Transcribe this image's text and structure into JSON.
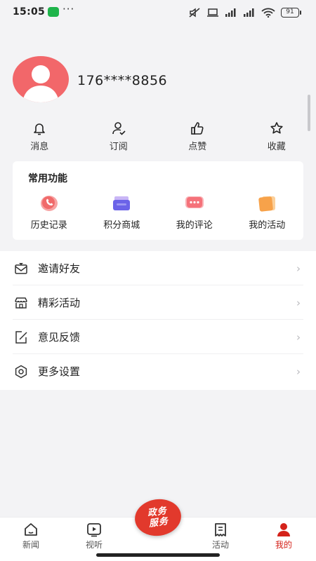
{
  "status_bar": {
    "time": "15:05",
    "battery": "91",
    "icons": [
      "wechat-icon",
      "more-dots-icon",
      "mute-icon",
      "laptop-icon",
      "signal-icon",
      "hd-signal-icon",
      "wifi-icon",
      "battery-icon"
    ]
  },
  "profile": {
    "phone": "176****8856"
  },
  "quick_actions": [
    {
      "label": "消息",
      "icon": "bell-icon"
    },
    {
      "label": "订阅",
      "icon": "user-check-icon"
    },
    {
      "label": "点赞",
      "icon": "thumbs-up-icon"
    },
    {
      "label": "收藏",
      "icon": "star-icon"
    }
  ],
  "common_functions": {
    "title": "常用功能",
    "items": [
      {
        "label": "历史记录",
        "icon": "history-icon",
        "color": "#f06a6a"
      },
      {
        "label": "积分商城",
        "icon": "points-mall-icon",
        "color": "#6b63e8"
      },
      {
        "label": "我的评论",
        "icon": "comment-icon",
        "color": "#f5727a"
      },
      {
        "label": "我的活动",
        "icon": "activity-icon",
        "color": "#f7a24a"
      }
    ]
  },
  "menu": [
    {
      "label": "邀请好友",
      "icon": "invite-mail-icon"
    },
    {
      "label": "精彩活动",
      "icon": "store-icon"
    },
    {
      "label": "意见反馈",
      "icon": "feedback-edit-icon"
    },
    {
      "label": "更多设置",
      "icon": "settings-gear-icon"
    }
  ],
  "chevron": "›",
  "bottom_nav": {
    "items": [
      {
        "label": "新闻",
        "icon": "home-icon",
        "active": false
      },
      {
        "label": "视听",
        "icon": "video-play-icon",
        "active": false
      },
      {
        "label": "活动",
        "icon": "receipt-icon",
        "active": false
      },
      {
        "label": "我的",
        "icon": "profile-icon",
        "active": true
      }
    ],
    "center": {
      "line1": "政务",
      "line2": "服务"
    }
  },
  "colors": {
    "accent": "#d4221a",
    "avatar_bg": "#f2676a",
    "center_button": "#e2392c"
  }
}
